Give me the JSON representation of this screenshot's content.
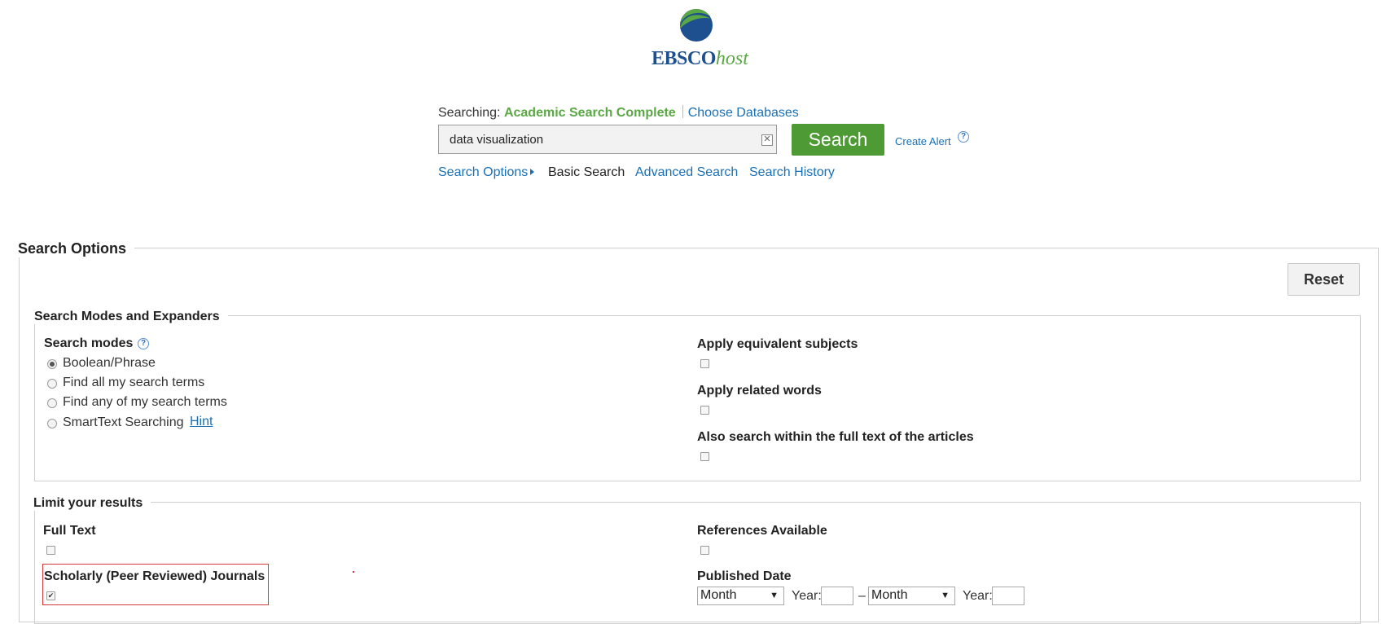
{
  "brand": {
    "logo_main": "EBSCO",
    "logo_accent": "host"
  },
  "search": {
    "searching_label": "Searching:",
    "database": "Academic Search Complete",
    "choose_databases": "Choose Databases",
    "query": "data visualization",
    "clear_glyph": "✕",
    "button": "Search",
    "create_alert": "Create Alert"
  },
  "nav": {
    "search_options": "Search Options",
    "basic_search": "Basic Search",
    "advanced_search": "Advanced Search",
    "search_history": "Search History"
  },
  "options": {
    "title": "Search Options",
    "reset": "Reset",
    "modes_section": "Search Modes and Expanders",
    "modes_label": "Search modes",
    "help_glyph": "?",
    "modes": [
      {
        "label": "Boolean/Phrase",
        "selected": true
      },
      {
        "label": "Find all my search terms",
        "selected": false
      },
      {
        "label": "Find any of my search terms",
        "selected": false
      },
      {
        "label": "SmartText Searching",
        "selected": false
      }
    ],
    "hint": "Hint",
    "expanders": [
      {
        "label": "Apply equivalent subjects",
        "checked": false
      },
      {
        "label": "Apply related words",
        "checked": false
      },
      {
        "label": "Also search within the full text of the articles",
        "checked": false
      }
    ]
  },
  "limits": {
    "title": "Limit your results",
    "full_text": {
      "label": "Full Text",
      "checked": false
    },
    "scholarly": {
      "label": "Scholarly (Peer Reviewed) Journals",
      "checked": true,
      "check_glyph": "✔"
    },
    "references": {
      "label": "References Available",
      "checked": false
    },
    "published_date": {
      "label": "Published Date",
      "from_month": "Month",
      "to_month": "Month",
      "year_label": "Year:",
      "dash": "–",
      "arrow_glyph": "▼"
    }
  },
  "colors": {
    "brand_blue": "#1e4f8f",
    "brand_green": "#5aa844",
    "button_green": "#4e9a34",
    "link": "#1a6fb5",
    "highlight_red": "#d9373a"
  }
}
